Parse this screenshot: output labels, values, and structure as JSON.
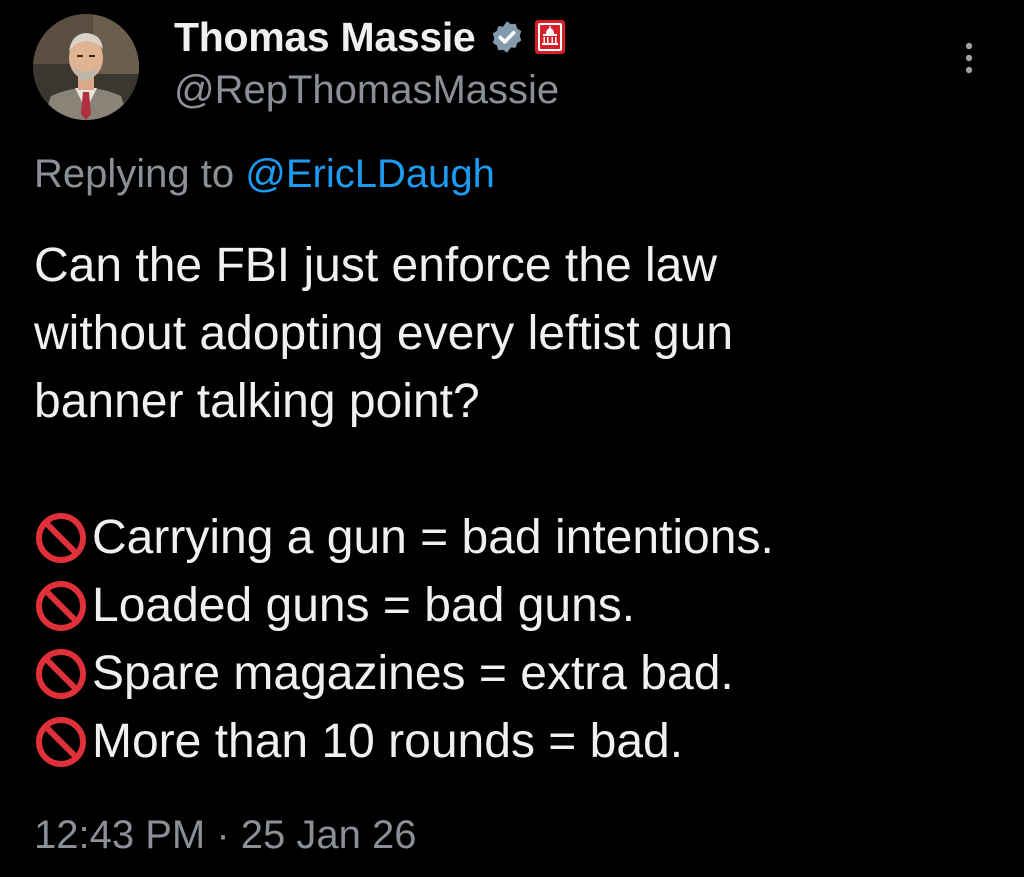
{
  "author": {
    "display_name": "Thomas Massie",
    "handle": "@RepThomasMassie",
    "verified_icon": "verified-badge",
    "affiliation_icon": "us-capitol-badge"
  },
  "reply_context": {
    "prefix": "Replying to ",
    "mention": "@EricLDaugh"
  },
  "body": {
    "lines": [
      "Can the FBI just enforce the law",
      "without adopting every leftist gun",
      "banner talking point?"
    ],
    "list_icon": "prohibited-emoji",
    "items": [
      "Carrying a gun = bad intentions.",
      "Loaded guns = bad guns.",
      "Spare magazines = extra bad.",
      "More than 10 rounds = bad."
    ]
  },
  "footer": {
    "time": "12:43 PM",
    "separator": " · ",
    "date": "25 Jan 26"
  },
  "colors": {
    "background": "#000000",
    "text": "#f0f0f0",
    "muted": "#8b9096",
    "link": "#1d9bf0",
    "verified": "#829aab",
    "prohibited": "#e0303a"
  }
}
